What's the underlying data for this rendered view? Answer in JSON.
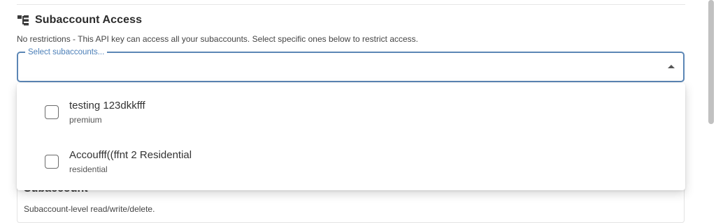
{
  "section": {
    "icon": "hierarchy-icon",
    "title": "Subaccount Access",
    "description": "No restrictions - This API key can access all your subaccounts. Select specific ones below to restrict access."
  },
  "select": {
    "label": "Select subaccounts...",
    "arrow_icon": "caret-up-icon",
    "accent_color": "#5b86b5"
  },
  "dropdown": {
    "options": [
      {
        "name": "testing 123dkkfff",
        "type": "premium",
        "checked": false
      },
      {
        "name": "Accoufff((ffnt 2 Residential",
        "type": "residential",
        "checked": false
      }
    ]
  },
  "below_card": {
    "title": "Subaccount",
    "description": "Subaccount-level read/write/delete."
  }
}
